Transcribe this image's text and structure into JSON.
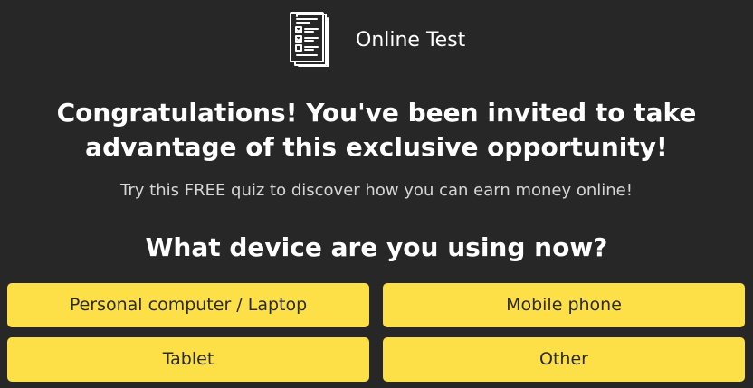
{
  "header": {
    "logo_icon": "quiz-checklist-icon",
    "title": "Online Test"
  },
  "headline": "Congratulations! You've been invited to take advantage of this exclusive opportunity!",
  "subheadline": "Try this FREE quiz to discover how you can earn money online!",
  "question": "What device are you using now?",
  "options": [
    {
      "label": "Personal computer / Laptop"
    },
    {
      "label": "Mobile phone"
    },
    {
      "label": "Tablet"
    },
    {
      "label": "Other"
    }
  ],
  "colors": {
    "background": "#272727",
    "option_bg": "#fde047",
    "option_text": "#2b2b2b",
    "text": "#ffffff"
  }
}
